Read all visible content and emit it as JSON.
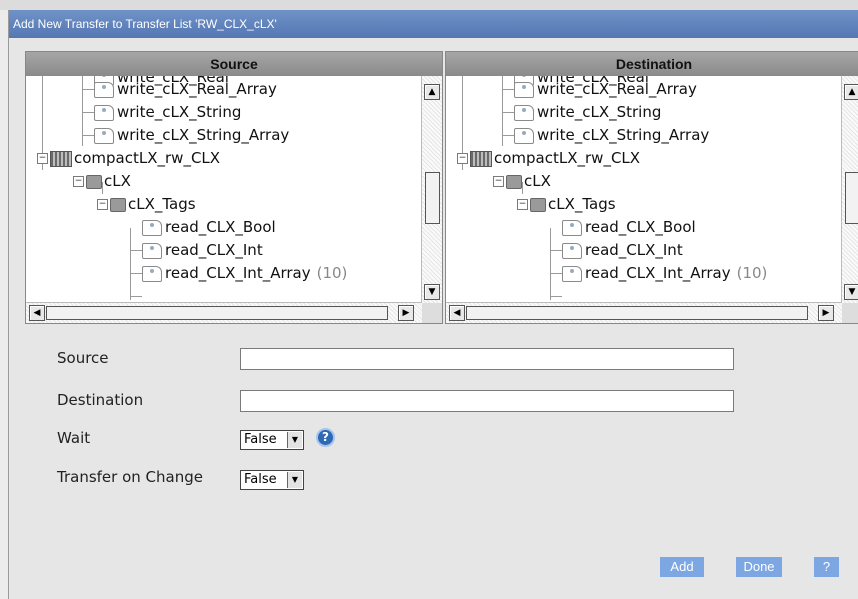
{
  "dialog": {
    "title": "Add New Transfer to Transfer List 'RW_CLX_cLX'"
  },
  "panes": {
    "source": {
      "header": "Source"
    },
    "destination": {
      "header": "Destination"
    }
  },
  "tree": {
    "items": [
      {
        "label": "write_cLX_Real",
        "count": ""
      },
      {
        "label": "write_cLX_Real_Array",
        "count": ""
      },
      {
        "label": "write_cLX_String",
        "count": ""
      },
      {
        "label": "write_cLX_String_Array",
        "count": ""
      },
      {
        "label": "compactLX_rw_CLX",
        "count": ""
      },
      {
        "label": "cLX",
        "count": ""
      },
      {
        "label": "cLX_Tags",
        "count": ""
      },
      {
        "label": "read_CLX_Bool",
        "count": ""
      },
      {
        "label": "read_CLX_Int",
        "count": ""
      },
      {
        "label": "read_CLX_Int_Array",
        "count": "(10)"
      }
    ],
    "expander_symbol": "−"
  },
  "form": {
    "source_label": "Source",
    "source_value": "",
    "destination_label": "Destination",
    "destination_value": "",
    "wait_label": "Wait",
    "wait_value": "False",
    "transfer_label": "Transfer on Change",
    "transfer_value": "False",
    "help_glyph": "?"
  },
  "buttons": {
    "add": "Add",
    "done": "Done",
    "help": "?"
  },
  "icons": {
    "scroll_up": "▲",
    "scroll_down": "▼",
    "scroll_left": "◀",
    "scroll_right": "▶",
    "dropdown": "▼"
  },
  "colors": {
    "title_bar": "#5f82bd",
    "button": "#7da7e2",
    "help_icon": "#2e69b6"
  }
}
